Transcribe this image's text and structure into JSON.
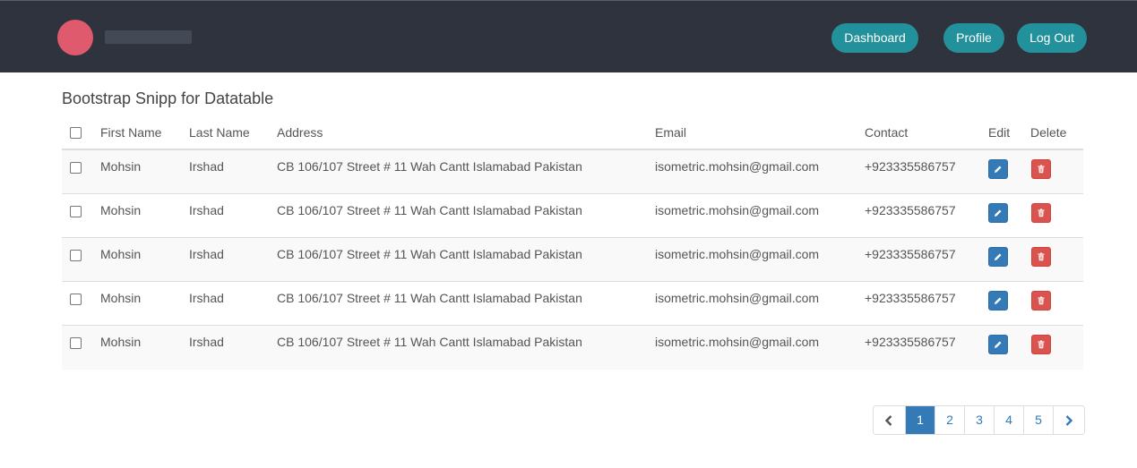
{
  "navbar": {
    "buttons": {
      "dashboard": "Dashboard",
      "profile": "Profile",
      "logout": "Log Out"
    },
    "logo_color": "#e05a6d",
    "bg_color": "#2f333e",
    "button_color": "#23919b"
  },
  "page": {
    "title": "Bootstrap Snipp for Datatable"
  },
  "table": {
    "headers": {
      "first_name": "First Name",
      "last_name": "Last Name",
      "address": "Address",
      "email": "Email",
      "contact": "Contact",
      "edit": "Edit",
      "delete": "Delete"
    },
    "rows": [
      {
        "first_name": "Mohsin",
        "last_name": "Irshad",
        "address": "CB 106/107 Street # 11 Wah Cantt Islamabad Pakistan",
        "email": "isometric.mohsin@gmail.com",
        "contact": "+923335586757"
      },
      {
        "first_name": "Mohsin",
        "last_name": "Irshad",
        "address": "CB 106/107 Street # 11 Wah Cantt Islamabad Pakistan",
        "email": "isometric.mohsin@gmail.com",
        "contact": "+923335586757"
      },
      {
        "first_name": "Mohsin",
        "last_name": "Irshad",
        "address": "CB 106/107 Street # 11 Wah Cantt Islamabad Pakistan",
        "email": "isometric.mohsin@gmail.com",
        "contact": "+923335586757"
      },
      {
        "first_name": "Mohsin",
        "last_name": "Irshad",
        "address": "CB 106/107 Street # 11 Wah Cantt Islamabad Pakistan",
        "email": "isometric.mohsin@gmail.com",
        "contact": "+923335586757"
      },
      {
        "first_name": "Mohsin",
        "last_name": "Irshad",
        "address": "CB 106/107 Street # 11 Wah Cantt Islamabad Pakistan",
        "email": "isometric.mohsin@gmail.com",
        "contact": "+923335586757"
      }
    ],
    "edit_icon": "pencil-icon",
    "delete_icon": "trash-icon",
    "edit_color": "#337ab7",
    "delete_color": "#d9534f"
  },
  "pagination": {
    "prev_icon": "chevron-left-icon",
    "next_icon": "chevron-right-icon",
    "pages": [
      "1",
      "2",
      "3",
      "4",
      "5"
    ],
    "active_page": "1"
  }
}
